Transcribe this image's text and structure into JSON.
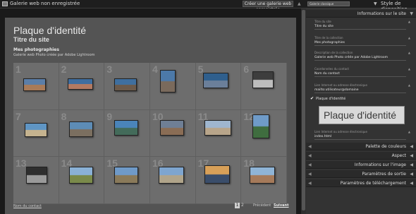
{
  "window": {
    "title": "Galerie web non enregistrée"
  },
  "toolbar": {
    "create_label": "Créer une galerie web enregistrée",
    "style_select": "Galerie classique"
  },
  "style_panel": {
    "label": "Style de disposition"
  },
  "site": {
    "title": "Plaque d'identité",
    "subtitle": "Titre du site",
    "collection_title": "Mes photographies",
    "collection_desc": "Galerie web Photo créée par Adobe Lightroom"
  },
  "grid": {
    "numbers": [
      "1",
      "2",
      "3",
      "4",
      "5",
      "6",
      "7",
      "8",
      "9",
      "10",
      "11",
      "12",
      "13",
      "14",
      "15",
      "16",
      "17",
      "18"
    ],
    "thumb_colors": [
      [
        "#5b7ea8",
        "#a97b58"
      ],
      [
        "#3f6ea0",
        "#b37a62"
      ],
      [
        "#3f6f9f",
        "#6c5a4a"
      ],
      [
        "#4c79a8",
        "#7a6a5c"
      ],
      [
        "#2f5f8d",
        "#6b7f9a"
      ],
      [
        "#3d3d3d",
        "#bdbdbd"
      ],
      [
        "#5f95c4",
        "#c5b38f"
      ],
      [
        "#5d8cb6",
        "#7b6f60"
      ],
      [
        "#4a84ba",
        "#436b5a"
      ],
      [
        "#6f7f95",
        "#8a6d55"
      ],
      [
        "#9fb6cf",
        "#b8a58a"
      ],
      [
        "#6f9bc8",
        "#3f6d3f"
      ],
      [
        "#2e2e2e",
        "#9a9a9a"
      ],
      [
        "#8ab1d6",
        "#7a8a4a"
      ],
      [
        "#6f9ac8",
        "#8a7a5a"
      ],
      [
        "#7ea5cf",
        "#b0a48a"
      ],
      [
        "#d8a058",
        "#3a4d6a"
      ],
      [
        "#8fb4d6",
        "#a57a5a"
      ]
    ]
  },
  "footer": {
    "contact_link": "Nom du contact",
    "page1": "1",
    "page2": "2",
    "prev": "Précédent",
    "next": "Suivant"
  },
  "panel": {
    "site_info_header": "Informations sur le site",
    "fields": [
      {
        "label": "Titre du site",
        "value": "Titre du site"
      },
      {
        "label": "Titre de la collection",
        "value": "Mes photographies"
      },
      {
        "label": "Description de la collection",
        "value": "Galerie web Photo créée par Adobe Lightroom"
      },
      {
        "label": "Coordonnées du contact",
        "value": "Nom du contact"
      },
      {
        "label": "Lien Internet ou adresse électronique",
        "value": "mailto:utilisateur@domaine"
      }
    ],
    "identity_check_label": "Plaque d'identité",
    "identity_text": "Plaque d'identité",
    "identity_link_label": "Lien Internet ou adresse électronique",
    "identity_link_value": "index.html",
    "sections": [
      "Palette de couleurs",
      "Aspect",
      "Informations sur l'image",
      "Paramètres de sortie",
      "Paramètres de téléchargement"
    ]
  }
}
